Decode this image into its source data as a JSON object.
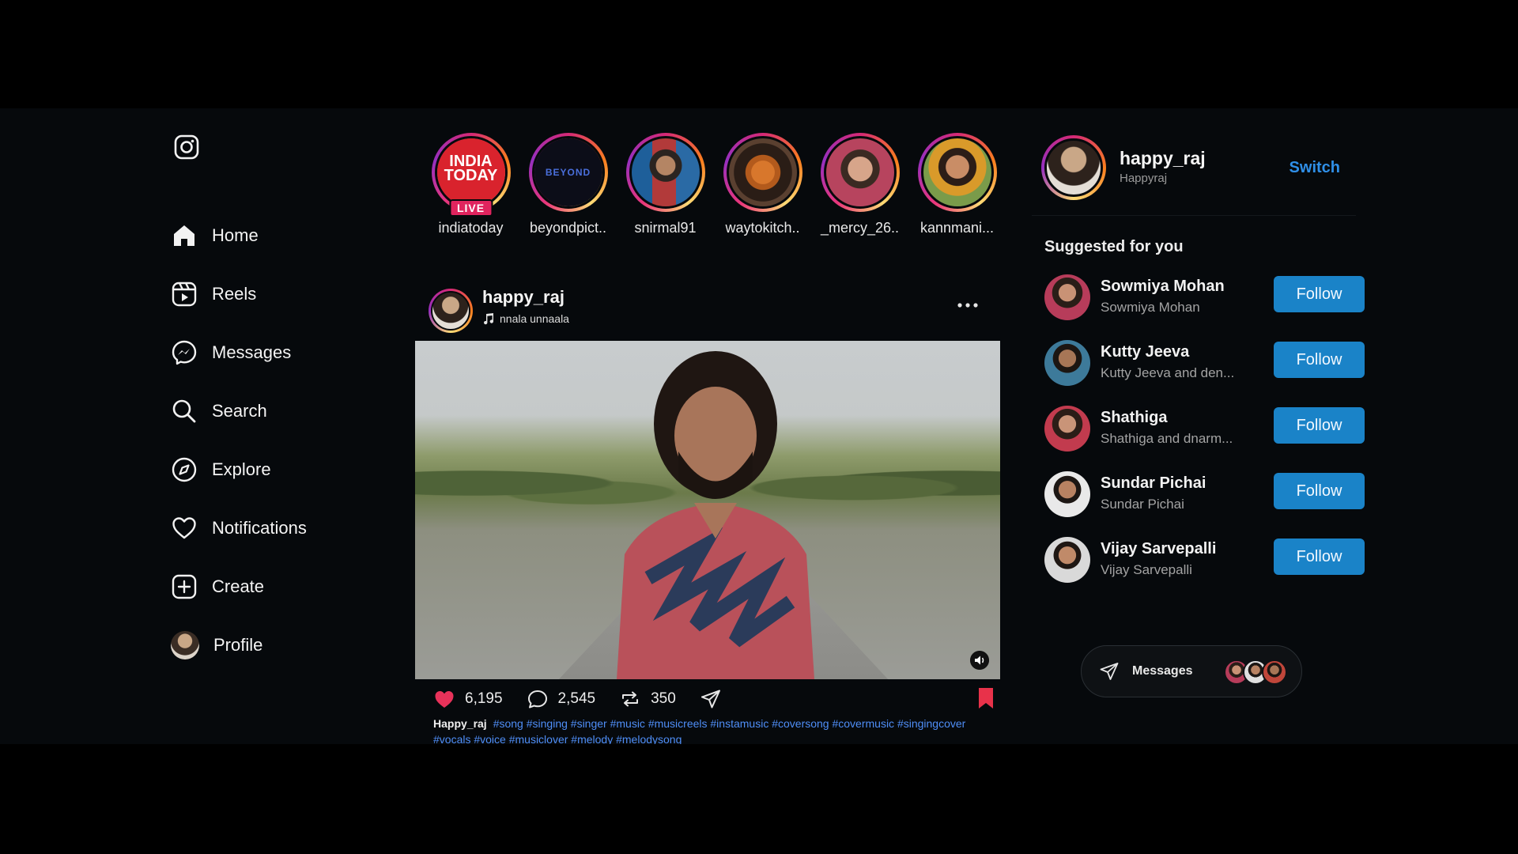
{
  "sidebar": {
    "items": [
      {
        "label": "Home"
      },
      {
        "label": "Reels"
      },
      {
        "label": "Messages"
      },
      {
        "label": "Search"
      },
      {
        "label": "Explore"
      },
      {
        "label": "Notifications"
      },
      {
        "label": "Create"
      },
      {
        "label": "Profile"
      }
    ]
  },
  "stories": [
    {
      "name": "indiatoday",
      "badge": "LIVE",
      "logo_lines": [
        "INDIA",
        "TODAY"
      ]
    },
    {
      "name": "beyondpict..",
      "logo_text": "BEYOND"
    },
    {
      "name": "snirmal91"
    },
    {
      "name": "waytokitch.."
    },
    {
      "name": "_mercy_26.."
    },
    {
      "name": "kannmani..."
    }
  ],
  "post": {
    "username": "happy_raj",
    "song": "nnala unnaala",
    "likes": "6,195",
    "comments": "2,545",
    "reposts": "350",
    "caption_user": "Happy_raj",
    "caption_tags": "#song #singing #singer #music #musicreels #instamusic #coversong #covermusic #singingcover #vocals #voice #musiclover #melody #melodysong"
  },
  "account": {
    "username": "happy_raj",
    "handle": "Happyraj",
    "switch_label": "Switch"
  },
  "suggestions": {
    "title": "Suggested for you",
    "follow_label": "Follow",
    "items": [
      {
        "name": "Sowmiya Mohan",
        "sub": "Sowmiya Mohan"
      },
      {
        "name": "Kutty Jeeva",
        "sub": "Kutty Jeeva and den..."
      },
      {
        "name": "Shathiga",
        "sub": "Shathiga and dnarm..."
      },
      {
        "name": "Sundar Pichai",
        "sub": "Sundar Pichai"
      },
      {
        "name": "Vijay Sarvepalli",
        "sub": "Vijay Sarvepalli"
      }
    ]
  },
  "messages_pill": {
    "label": "Messages"
  },
  "colors": {
    "accent_blue": "#1a83c8",
    "link_blue": "#2f8fe8",
    "hashtag_blue": "#4f8ef7",
    "like_red": "#e8325a",
    "bookmark_red": "#e8324a",
    "background": "#06090c"
  },
  "icons": {
    "logo": "instagram-icon",
    "nav": [
      "home-icon",
      "reels-icon",
      "messenger-icon",
      "search-icon",
      "compass-icon",
      "heart-icon",
      "plus-square-icon",
      "avatar"
    ],
    "post_actions": [
      "heart-icon",
      "comment-icon",
      "repost-icon",
      "send-icon",
      "bookmark-icon"
    ]
  }
}
